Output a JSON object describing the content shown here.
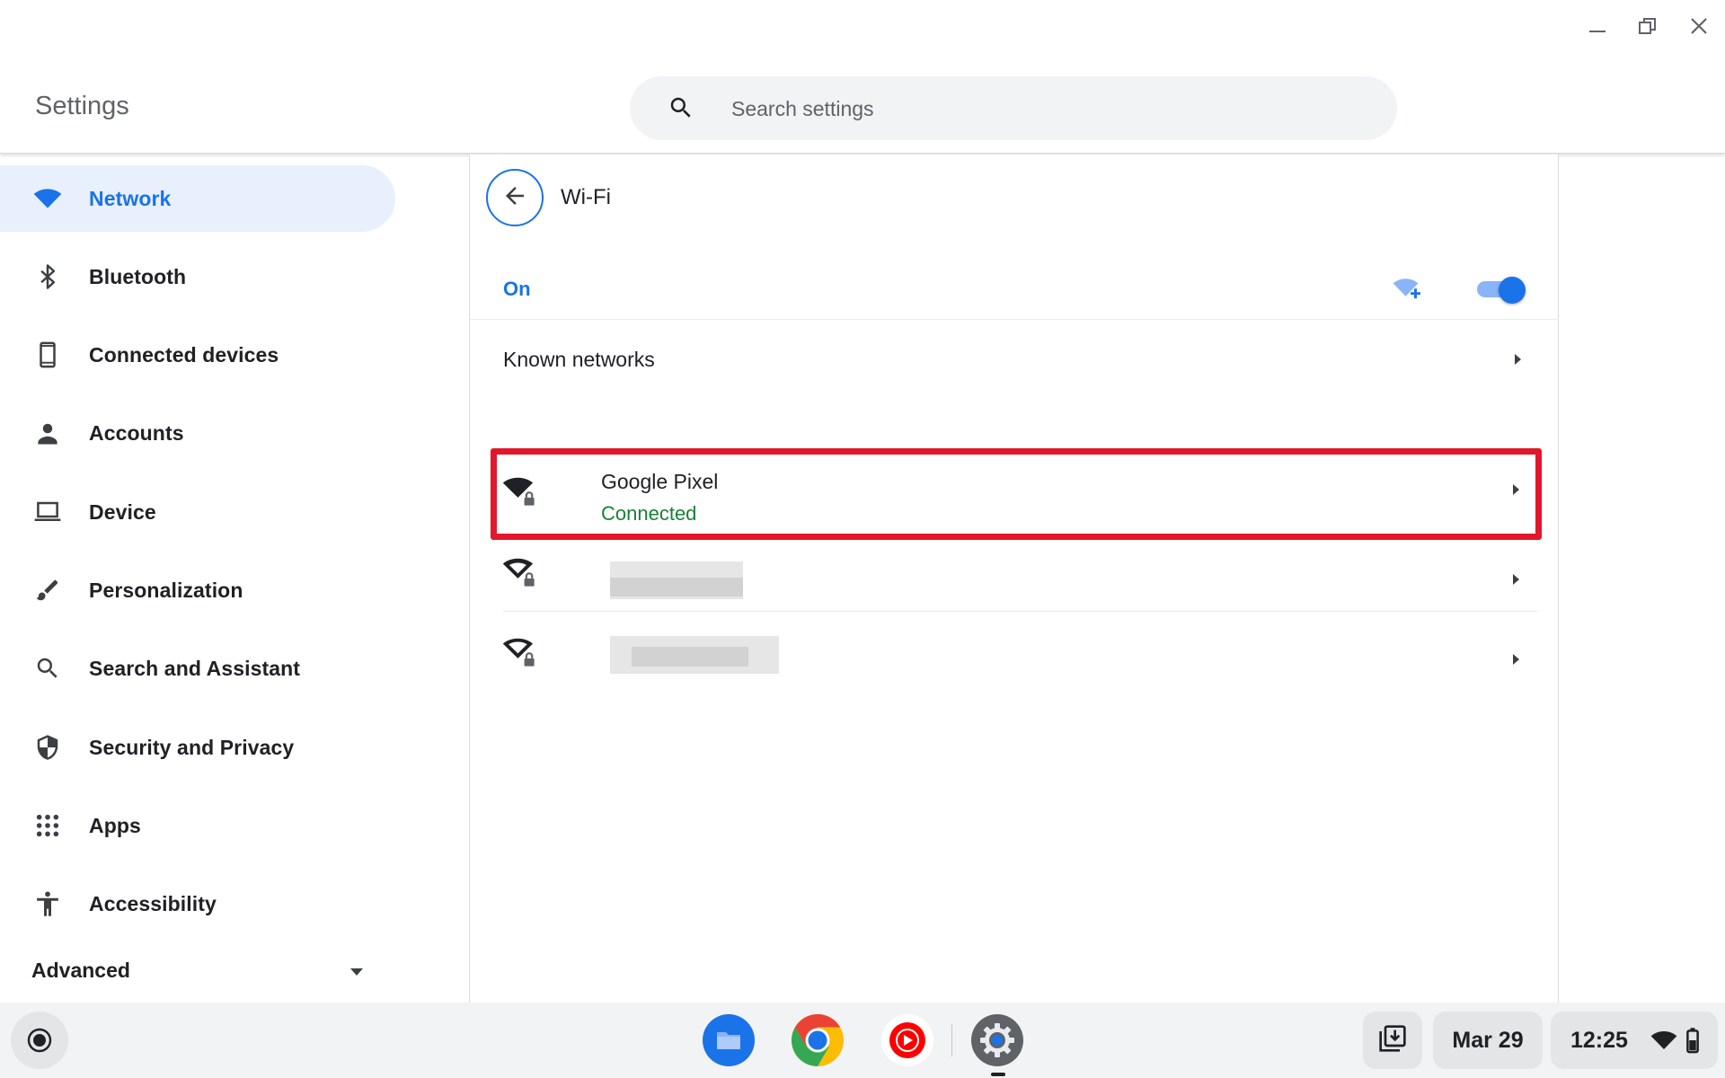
{
  "window": {
    "minimize_icon": "minimize-icon",
    "maximize_icon": "restore-icon",
    "close_icon": "close-icon"
  },
  "header": {
    "title": "Settings",
    "search_placeholder": "Search settings",
    "search_icon": "search-icon"
  },
  "sidebar": {
    "items": [
      {
        "label": "Network",
        "icon": "wifi-icon",
        "active": true
      },
      {
        "label": "Bluetooth",
        "icon": "bluetooth-icon"
      },
      {
        "label": "Connected devices",
        "icon": "phone-icon"
      },
      {
        "label": "Accounts",
        "icon": "person-icon"
      },
      {
        "label": "Device",
        "icon": "laptop-icon"
      },
      {
        "label": "Personalization",
        "icon": "brush-icon"
      },
      {
        "label": "Search and Assistant",
        "icon": "search-icon"
      },
      {
        "label": "Security and Privacy",
        "icon": "shield-icon"
      },
      {
        "label": "Apps",
        "icon": "apps-grid-icon"
      },
      {
        "label": "Accessibility",
        "icon": "accessibility-icon"
      }
    ],
    "advanced": {
      "label": "Advanced",
      "icon": "caret-down-icon"
    }
  },
  "main": {
    "title": "Wi-Fi",
    "back_icon": "back-arrow-icon",
    "wifi_state_label": "On",
    "wifi_enabled": true,
    "add_network_icon": "add-wifi-icon",
    "known_networks_label": "Known networks",
    "networks": [
      {
        "name": "Google Pixel",
        "status": "Connected",
        "secured": true,
        "highlighted": true
      },
      {
        "name": "",
        "status": "",
        "secured": true,
        "redacted": true
      },
      {
        "name": "",
        "status": "",
        "secured": true,
        "redacted": true
      }
    ]
  },
  "shelf": {
    "launcher_icon": "launcher-icon",
    "apps": [
      {
        "name": "Files",
        "icon": "files-icon"
      },
      {
        "name": "Chrome",
        "icon": "chrome-icon"
      },
      {
        "name": "YouTube Music",
        "icon": "youtube-music-icon"
      },
      {
        "name": "Settings",
        "icon": "settings-gear-icon",
        "running": true
      }
    ],
    "tray": {
      "holding_space_icon": "holding-space-icon",
      "date": "Mar 29",
      "time": "12:25",
      "wifi_icon": "wifi-icon",
      "battery_icon": "battery-icon"
    }
  },
  "colors": {
    "accent": "#1a73e8",
    "active_nav_bg": "#e8f0fe",
    "connected_green": "#188038",
    "highlight_red": "#e2172c"
  }
}
